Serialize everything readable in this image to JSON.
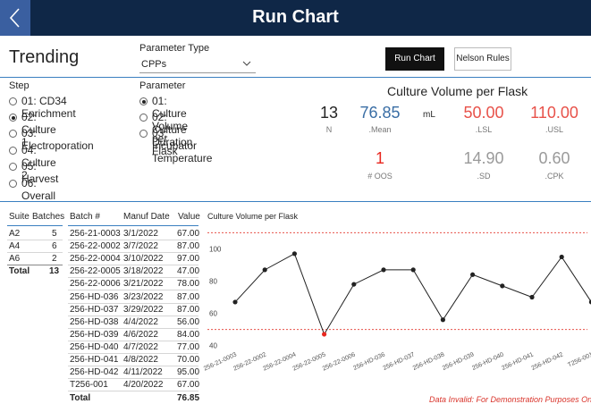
{
  "header": {
    "title": "Run Chart",
    "back_icon": "chevron-left-icon"
  },
  "trending": {
    "title": "Trending",
    "parameter_type_label": "Parameter Type",
    "parameter_type_value": "CPPs",
    "buttons": {
      "run_chart": "Run Chart",
      "nelson_rules": "Nelson Rules"
    }
  },
  "step": {
    "title": "Step",
    "items": [
      {
        "label": "01: CD34 Enrichment",
        "selected": false
      },
      {
        "label": "02: Culture 1",
        "selected": true
      },
      {
        "label": "03: Electroporation",
        "selected": false
      },
      {
        "label": "04: Culture 2",
        "selected": false
      },
      {
        "label": "05: Harvest",
        "selected": false
      },
      {
        "label": "06: Overall",
        "selected": false
      }
    ]
  },
  "parameter": {
    "title": "Parameter",
    "items": [
      {
        "label": "01: Culture Volume per Flask",
        "selected": true
      },
      {
        "label": "02: Culture Duration",
        "selected": false
      },
      {
        "label": "03: Incubator Temperature",
        "selected": false
      }
    ]
  },
  "kpis": {
    "title": "Culture Volume per Flask",
    "n": {
      "value": "13",
      "label": "N"
    },
    "mean": {
      "value": "76.85",
      "unit": "mL",
      "label": ".Mean"
    },
    "lsl": {
      "value": "50.00",
      "label": ".LSL"
    },
    "usl": {
      "value": "110.00",
      "label": ".USL"
    },
    "oos": {
      "value": "1",
      "label": "# OOS"
    },
    "sd": {
      "value": "14.90",
      "label": ".SD"
    },
    "cpk": {
      "value": "0.60",
      "label": ".CPK"
    },
    "colors": {
      "mean": "#3a6ea5",
      "limit": "#e8524a",
      "muted": "#9a9a9a",
      "oos": "#e8271f"
    }
  },
  "suite_table": {
    "headers": [
      "Suite",
      "Batches"
    ],
    "rows": [
      [
        "A2",
        "5"
      ],
      [
        "A4",
        "6"
      ],
      [
        "A6",
        "2"
      ]
    ],
    "total": [
      "Total",
      "13"
    ]
  },
  "batch_table": {
    "headers": [
      "Batch #",
      "Manuf Date",
      "Value"
    ],
    "rows": [
      [
        "256-21-0003",
        "3/1/2022",
        "67.00"
      ],
      [
        "256-22-0002",
        "3/7/2022",
        "87.00"
      ],
      [
        "256-22-0004",
        "3/10/2022",
        "97.00"
      ],
      [
        "256-22-0005",
        "3/18/2022",
        "47.00"
      ],
      [
        "256-22-0006",
        "3/21/2022",
        "78.00"
      ],
      [
        "256-HD-036",
        "3/23/2022",
        "87.00"
      ],
      [
        "256-HD-037",
        "3/29/2022",
        "87.00"
      ],
      [
        "256-HD-038",
        "4/4/2022",
        "56.00"
      ],
      [
        "256-HD-039",
        "4/6/2022",
        "84.00"
      ],
      [
        "256-HD-040",
        "4/7/2022",
        "77.00"
      ],
      [
        "256-HD-041",
        "4/8/2022",
        "70.00"
      ],
      [
        "256-HD-042",
        "4/11/2022",
        "95.00"
      ],
      [
        "T256-001",
        "4/20/2022",
        "67.00"
      ]
    ],
    "total": [
      "Total",
      "",
      "76.85"
    ]
  },
  "chart_data": {
    "type": "line",
    "title": "Culture Volume per Flask",
    "categories": [
      "256-21-0003",
      "256-22-0002",
      "256-22-0004",
      "256-22-0005",
      "256-22-0006",
      "256-HD-036",
      "256-HD-037",
      "256-HD-038",
      "256-HD-039",
      "256-HD-040",
      "256-HD-041",
      "256-HD-042",
      "T256-001"
    ],
    "values": [
      67,
      87,
      97,
      47,
      78,
      87,
      87,
      56,
      84,
      77,
      70,
      95,
      67
    ],
    "out_of_spec_index": 3,
    "yticks": [
      40,
      60,
      80,
      100
    ],
    "ylim": [
      37,
      113
    ],
    "lsl": 50,
    "usl": 110,
    "colors": {
      "line": "#222222",
      "point": "#222222",
      "oos_point": "#e8271f",
      "limit": "#e8524a"
    }
  },
  "disclaimer": "Data Invalid: For Demonstration Purposes Only"
}
